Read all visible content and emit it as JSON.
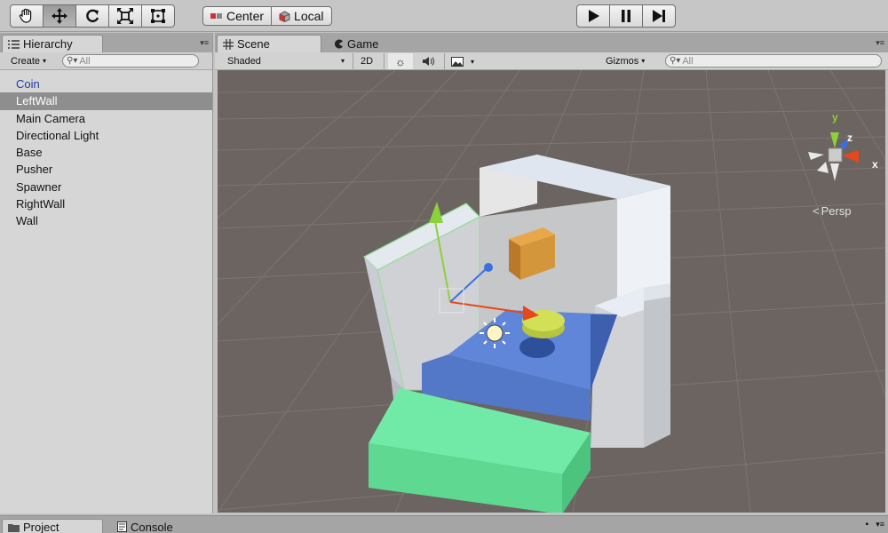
{
  "toolbar": {
    "tools": [
      "hand-tool",
      "move-tool",
      "rotate-tool",
      "scale-tool",
      "rect-tool"
    ],
    "pivot_label": "Center",
    "space_label": "Local"
  },
  "hierarchy": {
    "tab_label": "Hierarchy",
    "create_label": "Create",
    "search_placeholder": "All",
    "items": [
      {
        "label": "Coin"
      },
      {
        "label": "LeftWall"
      },
      {
        "label": "Main Camera"
      },
      {
        "label": "Directional Light"
      },
      {
        "label": "Base"
      },
      {
        "label": "Pusher"
      },
      {
        "label": "Spawner"
      },
      {
        "label": "RightWall"
      },
      {
        "label": "Wall"
      }
    ],
    "selected_index": 1
  },
  "scene": {
    "tab_label": "Scene",
    "game_tab_label": "Game",
    "shading_mode": "Shaded",
    "mode_2d": "2D",
    "gizmos_label": "Gizmos",
    "search_placeholder": "All",
    "projection_label": "Persp",
    "axis_labels": {
      "x": "x",
      "y": "y",
      "z": "z"
    }
  },
  "bottom": {
    "project_tab": "Project",
    "console_tab": "Console"
  },
  "colors": {
    "selection": "#8e8e8e",
    "coin_text": "#1f3aa8",
    "scene_bg": "#6b6460",
    "axis_x": "#e8461c",
    "axis_y": "#8bd13a",
    "axis_z": "#3a6fe0",
    "pusher": "#6ee6a0",
    "base": "#5f86d8",
    "spawner": "#d4963a",
    "coin": "#c9d84a"
  }
}
